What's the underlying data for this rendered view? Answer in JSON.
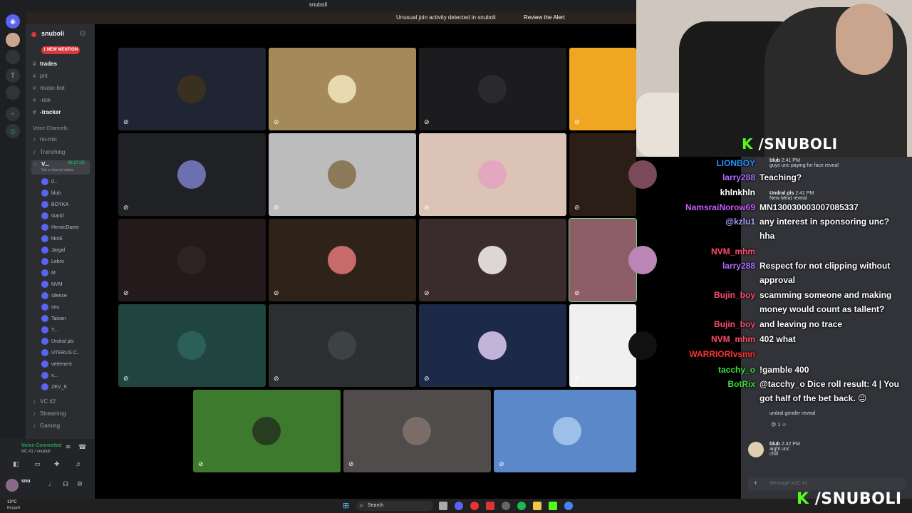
{
  "window": {
    "title": "snuboli"
  },
  "alert": {
    "message": "Unusual join activity detected in snuboli",
    "action": "Review the Alert"
  },
  "server": {
    "name": "snuboli",
    "mention_badge": "1 NEW MENTION"
  },
  "channels": [
    {
      "label": "trades",
      "bright": true
    },
    {
      "label": "pnl",
      "bright": false
    },
    {
      "label": "music-bot",
      "bright": false
    },
    {
      "label": "-rick",
      "bright": false
    },
    {
      "label": "-tracker",
      "bright": true
    }
  ],
  "voice_section": {
    "header": "Voice Channels",
    "channels": [
      "no-mic",
      "Trenching"
    ],
    "active_channel": "V...",
    "active_timer": "40:27:32",
    "status_hint": "Set a channel status"
  },
  "voice_users": [
    "0...",
    "blub",
    "BOYKA",
    "Garid",
    "HeroicDame",
    "hknE",
    "Jargal",
    "Lebro",
    "M",
    "NVM",
    "silence",
    "snu",
    "Taivan",
    "T...",
    "Undral pls",
    "UTERUS C...",
    "vetement",
    "x...",
    "ZEV_9"
  ],
  "more_voice": [
    "VC #2",
    "Streaming",
    "Gaming"
  ],
  "voice_panel": {
    "status": "Voice Connected",
    "sub": "VC #1 / snuboli"
  },
  "user_panel": {
    "name": "snu"
  },
  "tiles": [
    {
      "bg": "#1f2533",
      "av": "#3a3020"
    },
    {
      "bg": "#a4895a",
      "av": "#e7d9b0"
    },
    {
      "bg": "#1c1c1f",
      "av": "#2a2a2e"
    },
    {
      "bg": "#f1a623",
      "av": "#f1a623"
    },
    {
      "bg": "#202124",
      "av": "#6c6fb0"
    },
    {
      "bg": "#bcbcbc",
      "av": "#8a7a5a"
    },
    {
      "bg": "#dbc3b5",
      "av": "#e3a8c0"
    },
    {
      "bg": "#2a1e17",
      "av": "#7a4a5a"
    },
    {
      "bg": "#241a1c",
      "av": "#2d2224"
    },
    {
      "bg": "#2f2219",
      "av": "#c76a6a"
    },
    {
      "bg": "#3a2c2c",
      "av": "#dcd6d6"
    },
    {
      "bg": "#8e5e66",
      "av": "#b986b6"
    },
    {
      "bg": "#204540",
      "av": "#2d5f5a"
    },
    {
      "bg": "#2b2f2f",
      "av": "#3d4242"
    },
    {
      "bg": "#1c2a48",
      "av": "#c2b3d8"
    },
    {
      "bg": "#f0f0f0",
      "av": "#111111"
    },
    {
      "bg": "#3d7a2e",
      "av": "#283d1f"
    },
    {
      "bg": "#4f4c4b",
      "av": "#7a6c66"
    },
    {
      "bg": "#5b88c8",
      "av": "#9cc0e8"
    }
  ],
  "brand": {
    "text": "/SNUBOLI",
    "k": "K"
  },
  "chat_overlay": [
    {
      "user": "LIONBOY",
      "text": "",
      "color": "#1e90ff"
    },
    {
      "user": "larry288",
      "text": "Teaching?",
      "color": "#b06cff"
    },
    {
      "user": "khlnkhln",
      "text": "",
      "color": "#ffffff"
    },
    {
      "user": "NamsraiNorow69",
      "text": "MN130030003007085337",
      "color": "#c75cff"
    },
    {
      "user": "@kzlu1",
      "text": "any interest in sponsoring unc?",
      "color": "#a3a3ff"
    },
    {
      "user": "",
      "text": "hha",
      "color": "#ffffff"
    },
    {
      "user": "NVM_mhm",
      "text": "",
      "color": "#ff4a6a"
    },
    {
      "user": "larry288",
      "text": "Respect for not clipping without",
      "color": "#b06cff"
    },
    {
      "user": "",
      "text": "approval",
      "color": "#ffffff"
    },
    {
      "user": "Bujin_boy",
      "text": "scamming someone and making",
      "color": "#ff4a6a"
    },
    {
      "user": "",
      "text": "money would count as tallent?",
      "color": "#ffffff"
    },
    {
      "user": "Bujin_boy",
      "text": "and leaving no trace",
      "color": "#ff4a6a"
    },
    {
      "user": "NVM_mhm",
      "text": "402 what",
      "color": "#ff4a6a"
    },
    {
      "user": "WARRIORlvsmn",
      "text": "",
      "color": "#ff3030"
    },
    {
      "user": "tacchy_o",
      "text": "!gamble 400",
      "color": "#3cdc3c"
    },
    {
      "user": "BotRix",
      "text": "@tacchy_o Dice roll result: 4 | You",
      "color": "#3cdc3c"
    },
    {
      "user": "",
      "text": "got half of the bet back. 😐",
      "color": "#ffffff"
    }
  ],
  "discord_chat": [
    {
      "name": "blub",
      "time": "2:41 PM",
      "text": "guys unc paying for face reveal"
    },
    {
      "name": "Undral pls",
      "time": "2:41 PM",
      "text": "New Meat reveal"
    },
    {
      "name": "",
      "time": "",
      "text": "undral gender reveal"
    },
    {
      "name": "blub",
      "time": "2:42 PM",
      "text": "aight unc"
    },
    {
      "name": "",
      "time": "",
      "text": "chill"
    }
  ],
  "message_box": {
    "placeholder": "Message #VC #1"
  },
  "taskbar": {
    "weather": "13°C",
    "location": "Rozgarli",
    "search": "Search"
  }
}
